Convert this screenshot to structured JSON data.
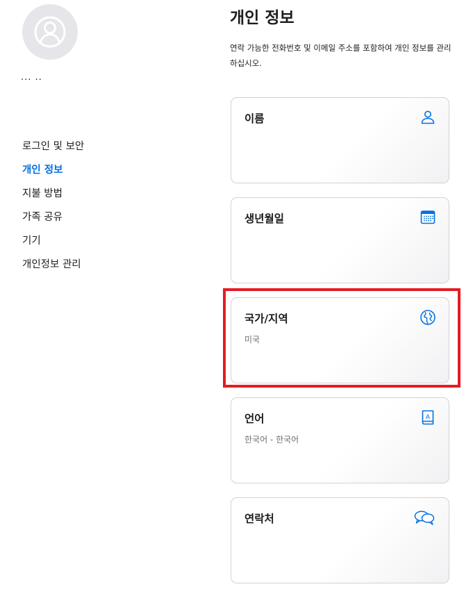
{
  "sidebar": {
    "user_name": "... ..",
    "items": [
      {
        "label": "로그인 및 보안",
        "active": false
      },
      {
        "label": "개인 정보",
        "active": true
      },
      {
        "label": "지불 방법",
        "active": false
      },
      {
        "label": "가족 공유",
        "active": false
      },
      {
        "label": "기기",
        "active": false
      },
      {
        "label": "개인정보 관리",
        "active": false
      }
    ]
  },
  "main": {
    "title": "개인 정보",
    "description": "연락 가능한 전화번호 및 이메일 주소를 포함하여 개인 정보를 관리하십시오.",
    "cards": [
      {
        "title": "이름",
        "value": "",
        "icon": "person-icon"
      },
      {
        "title": "생년월일",
        "value": "",
        "icon": "calendar-icon"
      },
      {
        "title": "국가/지역",
        "value": "미국",
        "icon": "globe-icon"
      },
      {
        "title": "언어",
        "value": "한국어 - 한국어",
        "icon": "book-icon"
      },
      {
        "title": "연락처",
        "value": "",
        "icon": "chat-bubbles-icon"
      }
    ]
  },
  "colors": {
    "accent": "#0071e3",
    "highlight": "#e41c23",
    "text": "#1d1d1f",
    "secondary_text": "#6e6e73"
  }
}
